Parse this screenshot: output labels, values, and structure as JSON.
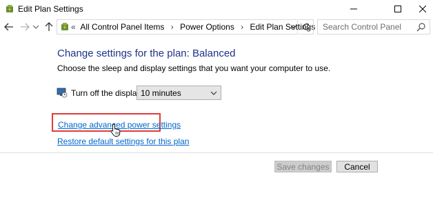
{
  "window": {
    "title": "Edit Plan Settings",
    "icon": "power-plan-icon"
  },
  "nav": {
    "back_icon": "arrow-left-icon",
    "forward_icon": "arrow-right-icon",
    "up_icon": "arrow-up-icon",
    "breadcrumb_lead": "«",
    "breadcrumbs": [
      "All Control Panel Items",
      "Power Options",
      "Edit Plan Settings"
    ],
    "breadcrumb_separator": "›",
    "search_placeholder": "Search Control Panel"
  },
  "main": {
    "heading": "Change settings for the plan: Balanced",
    "subtext": "Choose the sleep and display settings that you want your computer to use.",
    "display_label": "Turn off the display:",
    "display_value": "10 minutes",
    "link_advanced": "Change advanced power settings",
    "link_restore": "Restore default settings for this plan",
    "highlight_color": "#e23b3b",
    "link_color": "#0066cc",
    "heading_color": "#1e3287"
  },
  "footer": {
    "save_label": "Save changes",
    "save_enabled": false,
    "cancel_label": "Cancel"
  }
}
